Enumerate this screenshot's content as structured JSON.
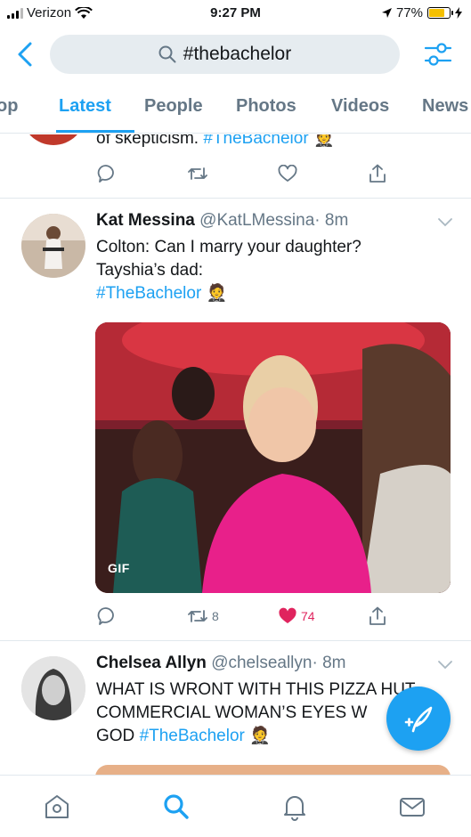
{
  "status_bar": {
    "carrier": "Verizon",
    "time": "9:27 PM",
    "battery": "77%",
    "battery_level": 0.77
  },
  "search": {
    "query": "#thebachelor",
    "icons": {
      "back": "chevron-left-icon",
      "search": "search-icon",
      "filter": "sliders-icon"
    }
  },
  "tabs": [
    {
      "label": "op"
    },
    {
      "label": "Latest",
      "active": true
    },
    {
      "label": "People"
    },
    {
      "label": "Photos"
    },
    {
      "label": "Videos"
    },
    {
      "label": "News"
    }
  ],
  "tweets": [
    {
      "text_prefix": "of skepticism.",
      "hashtag": "#TheBachelor",
      "actions": {
        "reply": "",
        "retweet": "",
        "like": ""
      }
    },
    {
      "name": "Kat Messina",
      "handle": "@KatLMessina",
      "separator": "·",
      "time": "8m",
      "lines": [
        "Colton: Can I marry your daughter?",
        "Tayshia’s dad:"
      ],
      "hashtag": "#TheBachelor",
      "media_badge": "GIF",
      "actions": {
        "retweets": "8",
        "likes": "74",
        "liked": true
      }
    },
    {
      "name": "Chelsea Allyn",
      "handle": "@chelseallyn",
      "separator": "·",
      "time": "8m",
      "lines": [
        "WHAT IS WRONT WITH THIS PIZZA HUT",
        "COMMERCIAL WOMAN’S EYES W"
      ],
      "line3_prefix": "GOD",
      "hashtag": "#TheBachelor"
    }
  ],
  "colors": {
    "accent": "#1da1f2",
    "like": "#e0245e",
    "muted": "#657786"
  },
  "bottom_nav": [
    "home-icon",
    "search-icon",
    "notifications-icon",
    "messages-icon"
  ]
}
